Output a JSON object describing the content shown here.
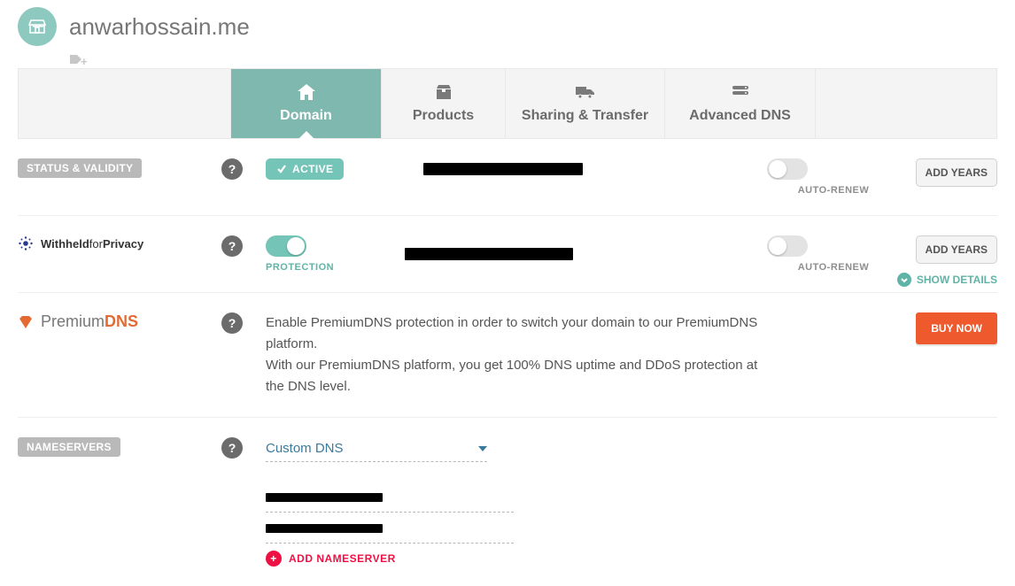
{
  "header": {
    "domain_title": "anwarhossain.me"
  },
  "tabs": {
    "domain": "Domain",
    "products": "Products",
    "sharing": "Sharing & Transfer",
    "advdns": "Advanced DNS"
  },
  "status_row": {
    "label": "STATUS & VALIDITY",
    "help_glyph": "?",
    "active_label": "ACTIVE",
    "auto_renew_label": "AUTO-RENEW",
    "add_years_label": "ADD YEARS"
  },
  "withheld_row": {
    "brand_prefix": "Withheld",
    "brand_mid": "for",
    "brand_suffix": "Privacy",
    "help_glyph": "?",
    "protection_label": "PROTECTION",
    "auto_renew_label": "AUTO-RENEW",
    "add_years_label": "ADD YEARS",
    "show_details_label": "SHOW DETAILS"
  },
  "premium_row": {
    "brand_prefix": "Premium",
    "brand_suffix": "DNS",
    "help_glyph": "?",
    "line1": "Enable PremiumDNS protection in order to switch your domain to our PremiumDNS platform.",
    "line2": "With our PremiumDNS platform, you get 100% DNS uptime and DDoS protection at the DNS level.",
    "buy_label": "BUY NOW"
  },
  "nameservers_row": {
    "label": "NAMESERVERS",
    "help_glyph": "?",
    "select_value": "Custom DNS",
    "add_label": "ADD NAMESERVER"
  }
}
